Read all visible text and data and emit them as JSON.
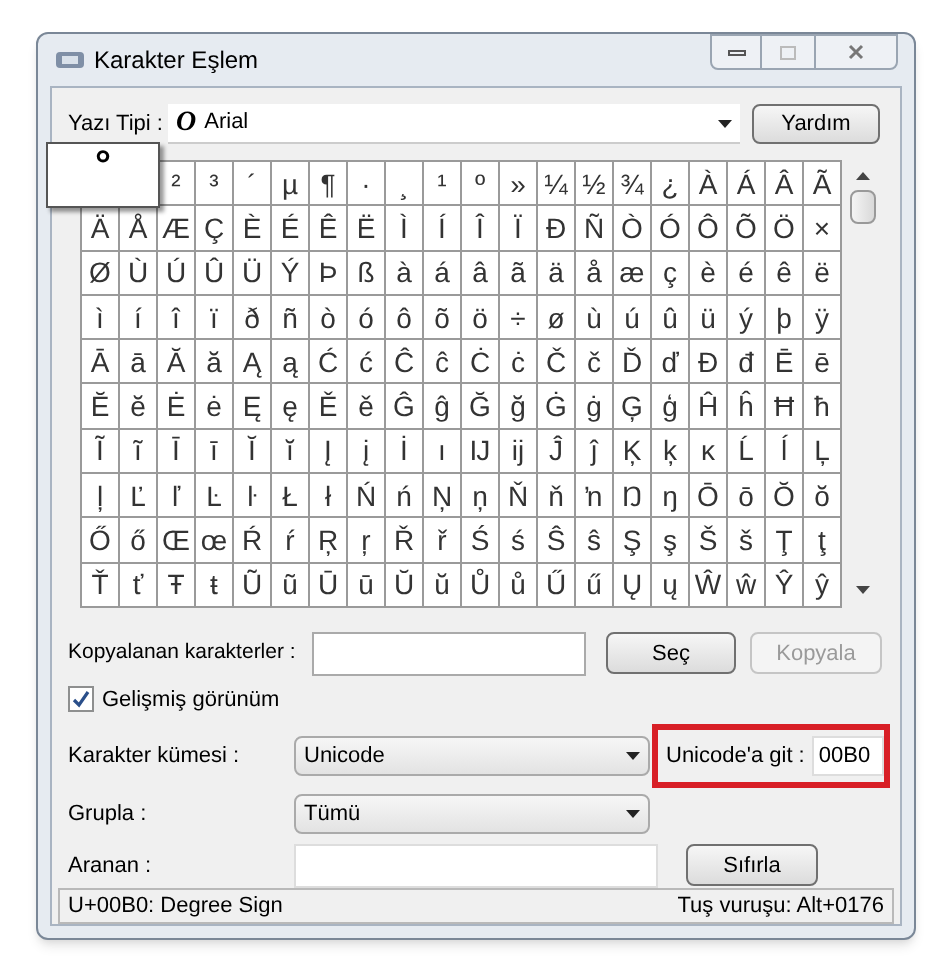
{
  "window": {
    "title": "Karakter Eşlem"
  },
  "font": {
    "label": "Yazı Tipi :",
    "glyph": "O",
    "value": "Arial"
  },
  "help_button": "Yardım",
  "grid": {
    "rows": [
      [
        null,
        null,
        "²",
        "³",
        "´",
        "µ",
        "¶",
        "·",
        "¸",
        "¹",
        "º",
        "»",
        "¼",
        "½",
        "¾",
        "¿",
        "À",
        "Á",
        "Â",
        "Ã"
      ],
      [
        "Ä",
        "Å",
        "Æ",
        "Ç",
        "È",
        "É",
        "Ê",
        "Ë",
        "Ì",
        "Í",
        "Î",
        "Ï",
        "Ð",
        "Ñ",
        "Ò",
        "Ó",
        "Ô",
        "Õ",
        "Ö",
        "×"
      ],
      [
        "Ø",
        "Ù",
        "Ú",
        "Û",
        "Ü",
        "Ý",
        "Þ",
        "ß",
        "à",
        "á",
        "â",
        "ã",
        "ä",
        "å",
        "æ",
        "ç",
        "è",
        "é",
        "ê",
        "ë"
      ],
      [
        "ì",
        "í",
        "î",
        "ï",
        "ð",
        "ñ",
        "ò",
        "ó",
        "ô",
        "õ",
        "ö",
        "÷",
        "ø",
        "ù",
        "ú",
        "û",
        "ü",
        "ý",
        "þ",
        "ÿ"
      ],
      [
        "Ā",
        "ā",
        "Ă",
        "ă",
        "Ą",
        "ą",
        "Ć",
        "ć",
        "Ĉ",
        "ĉ",
        "Ċ",
        "ċ",
        "Č",
        "č",
        "Ď",
        "ď",
        "Đ",
        "đ",
        "Ē",
        "ē"
      ],
      [
        "Ĕ",
        "ĕ",
        "Ė",
        "ė",
        "Ę",
        "ę",
        "Ě",
        "ě",
        "Ĝ",
        "ĝ",
        "Ğ",
        "ğ",
        "Ġ",
        "ġ",
        "Ģ",
        "ģ",
        "Ĥ",
        "ĥ",
        "Ħ",
        "ħ"
      ],
      [
        "Ĩ",
        "ĩ",
        "Ī",
        "ī",
        "Ĭ",
        "ĭ",
        "Į",
        "į",
        "İ",
        "ı",
        "Ĳ",
        "ĳ",
        "Ĵ",
        "ĵ",
        "Ķ",
        "ķ",
        "ĸ",
        "Ĺ",
        "ĺ",
        "Ļ"
      ],
      [
        "ļ",
        "Ľ",
        "ľ",
        "Ŀ",
        "ŀ",
        "Ł",
        "ł",
        "Ń",
        "ń",
        "Ņ",
        "ņ",
        "Ň",
        "ň",
        "ŉ",
        "Ŋ",
        "ŋ",
        "Ō",
        "ō",
        "Ŏ",
        "ŏ"
      ],
      [
        "Ő",
        "ő",
        "Œ",
        "œ",
        "Ŕ",
        "ŕ",
        "Ŗ",
        "ŗ",
        "Ř",
        "ř",
        "Ś",
        "ś",
        "Ŝ",
        "ŝ",
        "Ş",
        "ş",
        "Š",
        "š",
        "Ţ",
        "ţ"
      ],
      [
        "Ť",
        "ť",
        "Ŧ",
        "ŧ",
        "Ũ",
        "ũ",
        "Ū",
        "ū",
        "Ŭ",
        "ŭ",
        "Ů",
        "ů",
        "Ű",
        "ű",
        "Ų",
        "ų",
        "Ŵ",
        "ŵ",
        "Ŷ",
        "ŷ"
      ]
    ]
  },
  "magnified": "°",
  "copy": {
    "label": "Kopyalanan karakterler :",
    "select_button": "Seç",
    "copy_button": {
      "label": "Kopyala",
      "disabled": true
    }
  },
  "advanced": {
    "label": "Gelişmiş görünüm",
    "checked": true
  },
  "charset": {
    "label": "Karakter kümesi :",
    "value": "Unicode"
  },
  "goto": {
    "label": "Unicode'a git :",
    "value": "00B0"
  },
  "group": {
    "label": "Grupla :",
    "value": "Tümü"
  },
  "search": {
    "label": "Aranan :",
    "button": "Sıfırla"
  },
  "status": {
    "left": "U+00B0: Degree Sign",
    "right": "Tuş vuruşu: Alt+0176"
  }
}
